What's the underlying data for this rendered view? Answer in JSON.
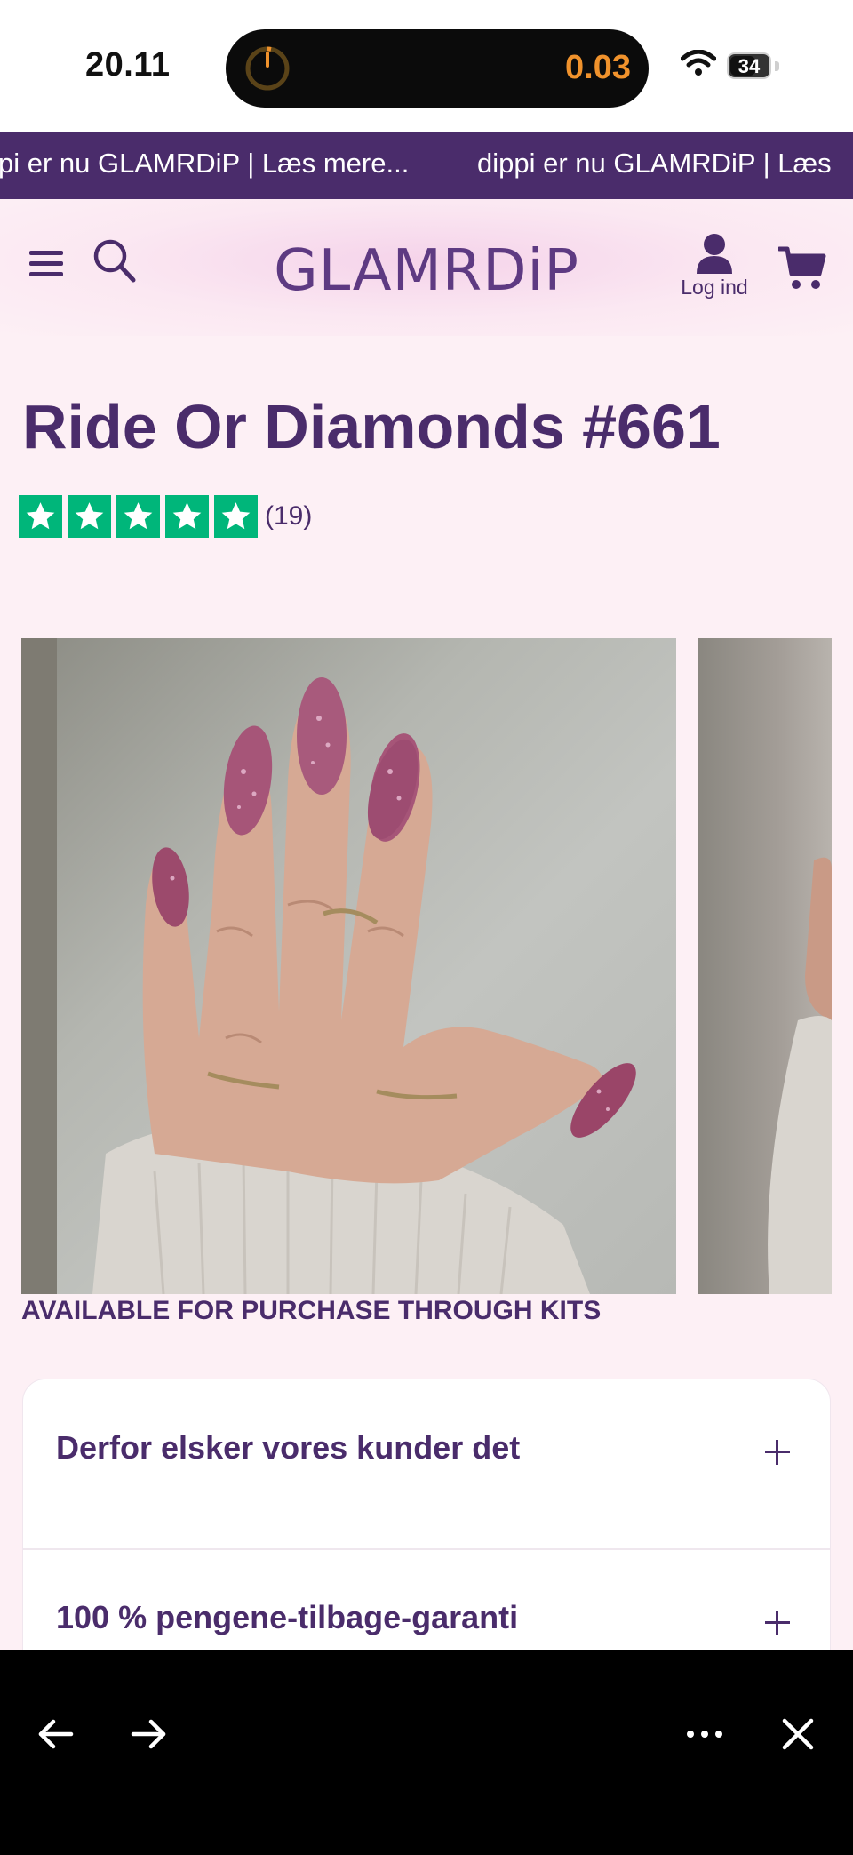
{
  "status_bar": {
    "time": "20.11",
    "activity_value": "0.03",
    "battery": "34"
  },
  "announcement": {
    "segments": [
      "pi er nu GLAMRDiP | Læs mere...",
      "dippi er nu GLAMRDiP | Læs"
    ]
  },
  "header": {
    "logo": "GLAMRDiP",
    "account_label": "Log ind"
  },
  "product": {
    "title": "Ride Or Diamonds #661",
    "rating_stars": 5,
    "rating_count": "(19)",
    "availability_note": "AVAILABLE FOR PURCHASE THROUGH KITS"
  },
  "accordion": {
    "items": [
      {
        "label": "Derfor elsker vores kunder det"
      },
      {
        "label": "100 % pengene-tilbage-garanti"
      }
    ]
  },
  "colors": {
    "brand_purple": "#4a2c6b",
    "rating_green": "#00b67a",
    "page_background": "#fdf0f5",
    "activity_orange": "#f0922c"
  },
  "icons": [
    "menu-icon",
    "search-icon",
    "account-icon",
    "cart-icon",
    "back-arrow-icon",
    "forward-arrow-icon",
    "more-icon",
    "close-icon",
    "wifi-icon",
    "timer-icon",
    "star-icon"
  ]
}
